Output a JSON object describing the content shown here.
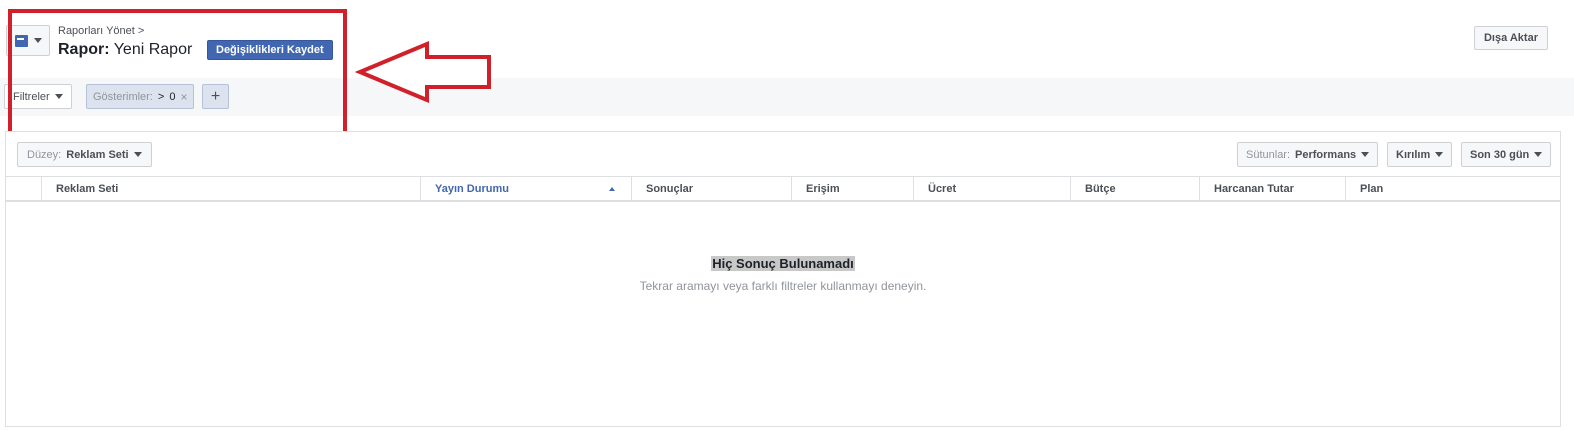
{
  "header": {
    "breadcrumb": "Raporları Yönet",
    "breadcrumb_separator": ">",
    "title_label": "Rapor:",
    "title_value": "Yeni Rapor",
    "save_label": "Değişiklikleri Kaydet",
    "export_label": "Dışa Aktar"
  },
  "filters": {
    "filters_label": "Filtreler",
    "chip": {
      "field": "Gösterimler:",
      "operator": ">",
      "value": "0",
      "remove": "×"
    },
    "add_label": "+"
  },
  "toolbar": {
    "level_label": "Düzey:",
    "level_value": "Reklam Seti",
    "columns_label": "Sütunlar:",
    "columns_value": "Performans",
    "breakdown_label": "Kırılım",
    "date_label": "Son 30 gün"
  },
  "table": {
    "columns": [
      "Reklam Seti",
      "Yayın Durumu",
      "Sonuçlar",
      "Erişim",
      "Ücret",
      "Bütçe",
      "Harcanan Tutar",
      "Plan"
    ],
    "sorted_column": "Yayın Durumu"
  },
  "empty_state": {
    "title": "Hiç Sonuç Bulunamadı",
    "subtitle": "Tekrar aramayı veya farklı filtreler kullanmayı deneyin."
  },
  "colors": {
    "accent": "#4267b2",
    "annotation": "#d0202a"
  }
}
